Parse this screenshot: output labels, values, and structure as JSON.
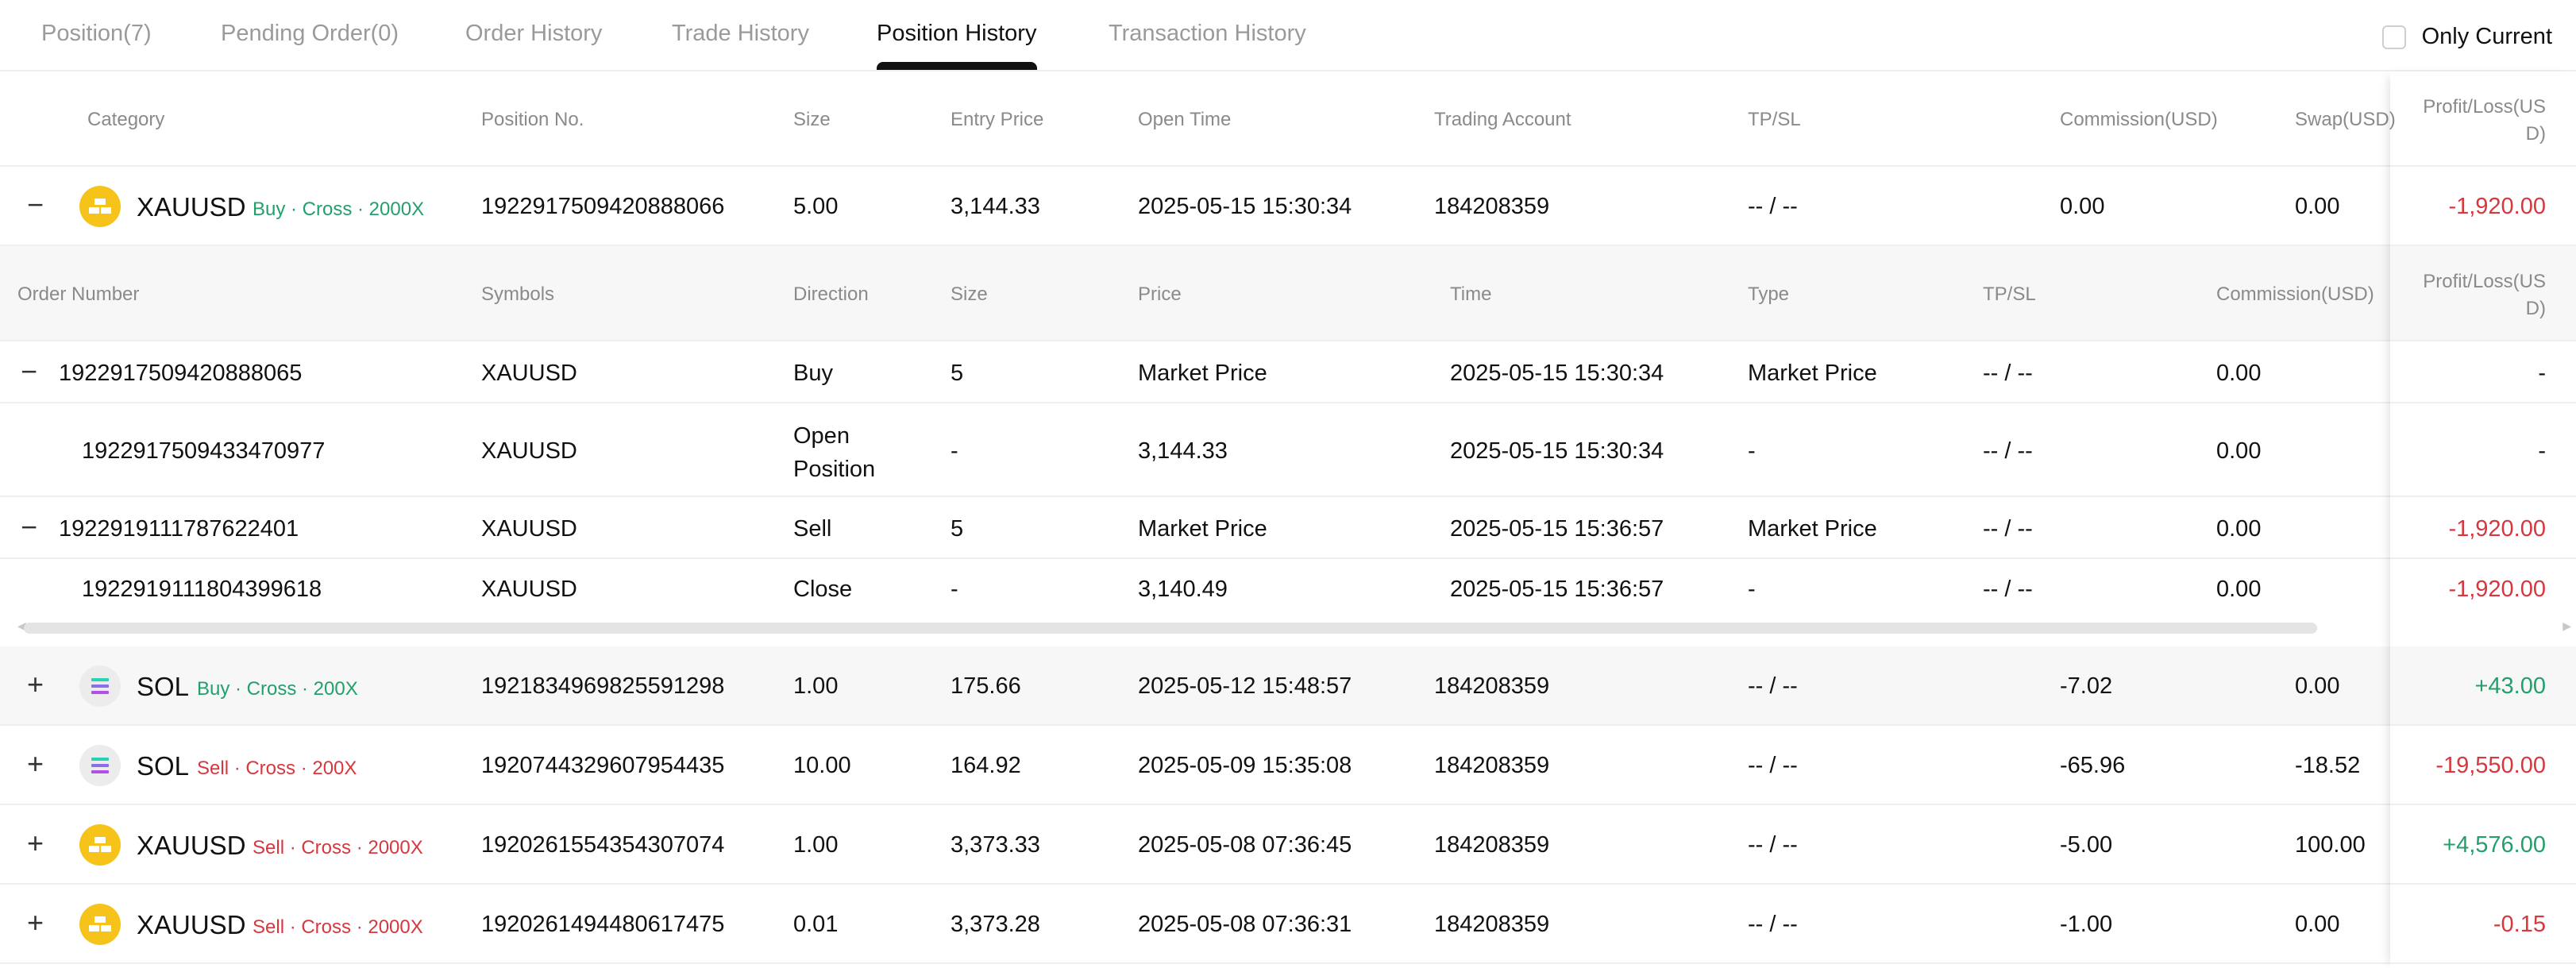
{
  "tabs": [
    {
      "label": "Position(7)"
    },
    {
      "label": "Pending Order(0)"
    },
    {
      "label": "Order History"
    },
    {
      "label": "Trade History"
    },
    {
      "label": "Position History",
      "active": true
    },
    {
      "label": "Transaction History"
    }
  ],
  "only_current": {
    "label": "Only Current",
    "checked": false
  },
  "main_headers": {
    "category": "Category",
    "position_no": "Position No.",
    "size": "Size",
    "entry_price": "Entry Price",
    "open_time": "Open Time",
    "trading_account": "Trading Account",
    "tpsl": "TP/SL",
    "commission": "Commission(USD)",
    "swap": "Swap(USD)",
    "pnl_line1": "Profit/Loss(US",
    "pnl_line2": "D)"
  },
  "positions": [
    {
      "expanded": true,
      "symbol": "XAUUSD",
      "icon": "gold-bars-icon",
      "tag": "Buy · Cross · 2000X",
      "tag_color": "#22a06b",
      "position_no": "1922917509420888066",
      "size": "5.00",
      "entry_price": "3,144.33",
      "open_time": "2025-05-15 15:30:34",
      "account": "184208359",
      "tpsl": "-- / --",
      "commission": "0.00",
      "swap": "0.00",
      "pnl": "-1,920.00",
      "pnl_color": "#d9363e"
    },
    {
      "expanded": false,
      "symbol": "SOL",
      "icon": "solana-icon",
      "tag": "Buy · Cross · 200X",
      "tag_color": "#22a06b",
      "position_no": "1921834969825591298",
      "size": "1.00",
      "entry_price": "175.66",
      "open_time": "2025-05-12 15:48:57",
      "account": "184208359",
      "tpsl": "-- / --",
      "commission": "-7.02",
      "swap": "0.00",
      "pnl": "+43.00",
      "pnl_color": "#22a06b"
    },
    {
      "expanded": false,
      "symbol": "SOL",
      "icon": "solana-icon",
      "tag": "Sell · Cross · 200X",
      "tag_color": "#d9363e",
      "position_no": "1920744329607954435",
      "size": "10.00",
      "entry_price": "164.92",
      "open_time": "2025-05-09 15:35:08",
      "account": "184208359",
      "tpsl": "-- / --",
      "commission": "-65.96",
      "swap": "-18.52",
      "pnl": "-19,550.00",
      "pnl_color": "#d9363e"
    },
    {
      "expanded": false,
      "symbol": "XAUUSD",
      "icon": "gold-bars-icon",
      "tag": "Sell · Cross · 2000X",
      "tag_color": "#d9363e",
      "position_no": "1920261554354307074",
      "size": "1.00",
      "entry_price": "3,373.33",
      "open_time": "2025-05-08 07:36:45",
      "account": "184208359",
      "tpsl": "-- / --",
      "commission": "-5.00",
      "swap": "100.00",
      "pnl": "+4,576.00",
      "pnl_color": "#22a06b"
    },
    {
      "expanded": false,
      "symbol": "XAUUSD",
      "icon": "gold-bars-icon",
      "tag": "Sell · Cross · 2000X",
      "tag_color": "#d9363e",
      "position_no": "1920261494480617475",
      "size": "0.01",
      "entry_price": "3,373.28",
      "open_time": "2025-05-08 07:36:31",
      "account": "184208359",
      "tpsl": "-- / --",
      "commission": "-1.00",
      "swap": "0.00",
      "pnl": "-0.15",
      "pnl_color": "#d9363e"
    }
  ],
  "sub_headers": {
    "order_number": "Order Number",
    "symbols": "Symbols",
    "direction": "Direction",
    "size": "Size",
    "price": "Price",
    "time": "Time",
    "type": "Type",
    "tpsl": "TP/SL",
    "commission": "Commission(USD)",
    "pnl_line1": "Profit/Loss(US",
    "pnl_line2": "D)"
  },
  "sub_rows": [
    {
      "toggle": "−",
      "order_number": "1922917509420888065",
      "symbol": "XAUUSD",
      "direction": "Buy",
      "direction2": "",
      "size": "5",
      "price": "Market Price",
      "time": "2025-05-15 15:30:34",
      "type": "Market Price",
      "tpsl": "-- / --",
      "commission": "0.00",
      "pnl": "-",
      "pnl_color": "#111111"
    },
    {
      "toggle": "",
      "order_number": "1922917509433470977",
      "symbol": "XAUUSD",
      "direction": "Open",
      "direction2": "Position",
      "size": "-",
      "price": "3,144.33",
      "time": "2025-05-15 15:30:34",
      "type": "-",
      "tpsl": "-- / --",
      "commission": "0.00",
      "pnl": "-",
      "pnl_color": "#111111"
    },
    {
      "toggle": "−",
      "order_number": "1922919111787622401",
      "symbol": "XAUUSD",
      "direction": "Sell",
      "direction2": "",
      "size": "5",
      "price": "Market Price",
      "time": "2025-05-15 15:36:57",
      "type": "Market Price",
      "tpsl": "-- / --",
      "commission": "0.00",
      "pnl": "-1,920.00",
      "pnl_color": "#d9363e"
    },
    {
      "toggle": "",
      "order_number": "1922919111804399618",
      "symbol": "XAUUSD",
      "direction": "Close",
      "direction2": "",
      "size": "-",
      "price": "3,140.49",
      "time": "2025-05-15 15:36:57",
      "type": "-",
      "tpsl": "-- / --",
      "commission": "0.00",
      "pnl": "-1,920.00",
      "pnl_color": "#d9363e"
    }
  ],
  "toggle_expanded": "−",
  "toggle_collapsed": "+",
  "colors": {
    "buy": "#22a06b",
    "sell": "#d9363e",
    "gold_icon": "#f6c31b"
  }
}
